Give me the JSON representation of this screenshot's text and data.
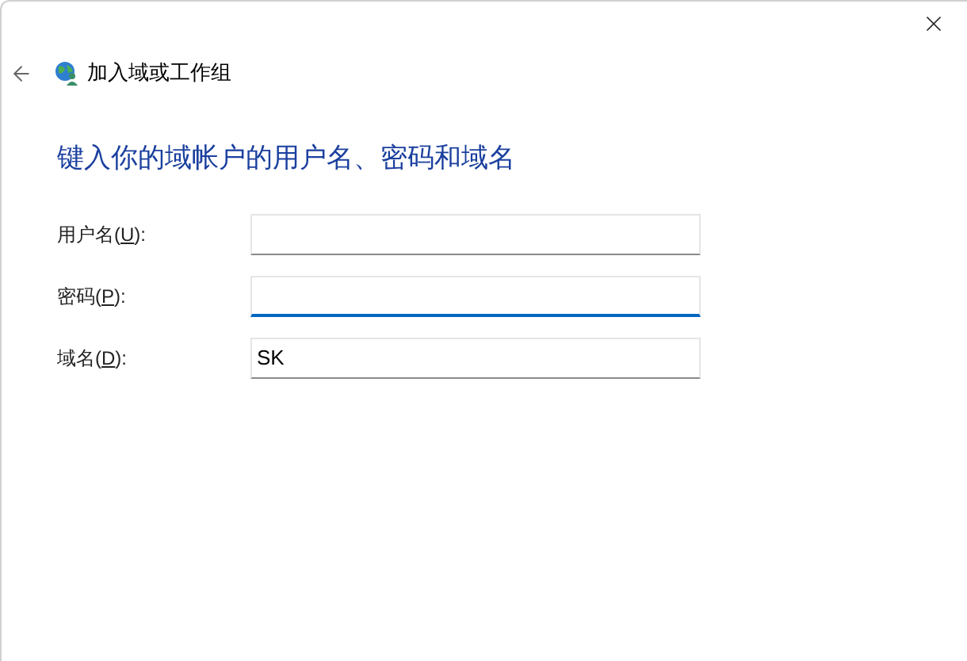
{
  "window": {
    "title": "加入域或工作组"
  },
  "heading": "键入你的域帐户的用户名、密码和域名",
  "fields": [
    {
      "label_before": "用户名(",
      "access_key": "U",
      "label_after": "):",
      "focused": false
    },
    {
      "label_before": "密码(",
      "access_key": "P",
      "label_after": "):",
      "focused": true
    },
    {
      "label_before": "域名(",
      "access_key": "D",
      "label_after": "):",
      "value": "SK",
      "focused": false
    }
  ]
}
